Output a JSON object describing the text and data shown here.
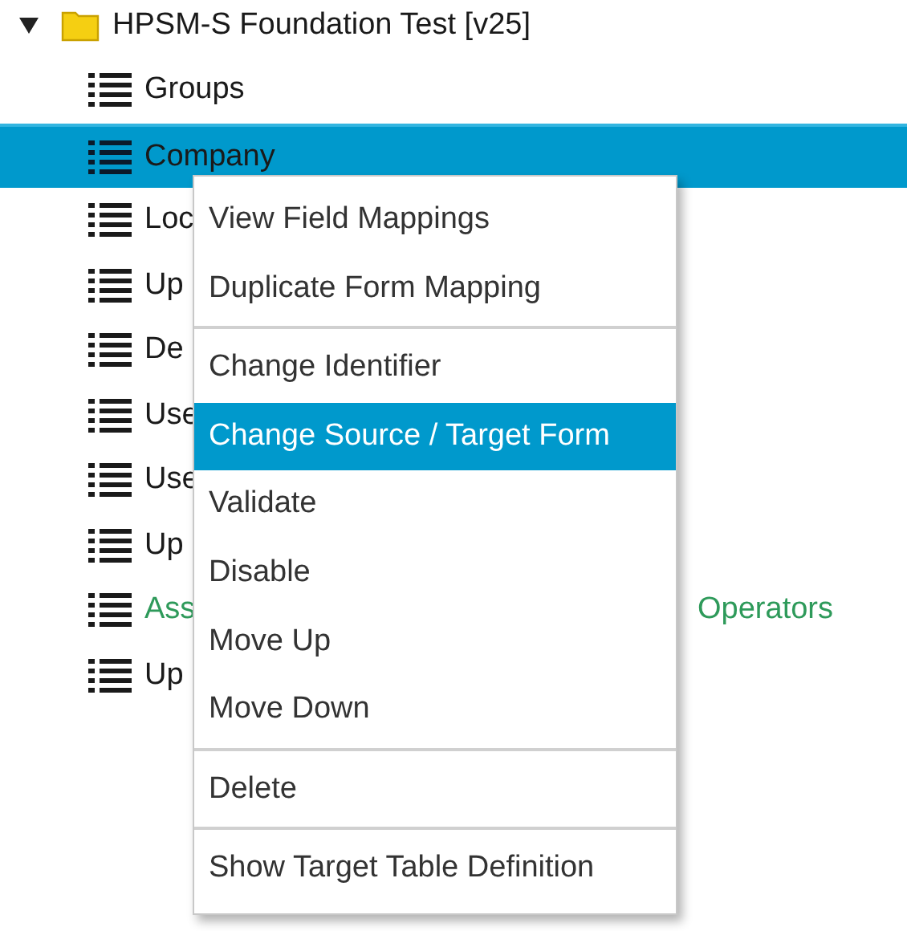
{
  "tree": {
    "root": {
      "label": "HPSM-S Foundation Test [v25]",
      "expanded": true,
      "children": [
        {
          "label": "Groups",
          "selected": false
        },
        {
          "label": "Company",
          "selected": true
        },
        {
          "label": "Loc",
          "selected": false
        },
        {
          "label": "Up",
          "selected": false
        },
        {
          "label": "De",
          "selected": false
        },
        {
          "label": "Use",
          "selected": false
        },
        {
          "label": "Use",
          "selected": false
        },
        {
          "label": "Up",
          "selected": false
        },
        {
          "label": "Ass",
          "label_tail": "Operators",
          "color": "#2e9a5a",
          "selected": false
        },
        {
          "label": "Up",
          "selected": false
        }
      ]
    }
  },
  "context_menu": {
    "groups": [
      [
        {
          "label": "View Field Mappings",
          "selected": false
        },
        {
          "label": "Duplicate Form Mapping",
          "selected": false
        }
      ],
      [
        {
          "label": "Change Identifier",
          "selected": false
        },
        {
          "label": "Change Source / Target Form",
          "selected": true
        },
        {
          "label": "Validate",
          "selected": false
        },
        {
          "label": "Disable",
          "selected": false
        },
        {
          "label": "Move Up",
          "selected": false
        },
        {
          "label": "Move Down",
          "selected": false
        }
      ],
      [
        {
          "label": "Delete",
          "selected": false
        }
      ],
      [
        {
          "label": "Show Target Table Definition",
          "selected": false
        }
      ]
    ]
  }
}
